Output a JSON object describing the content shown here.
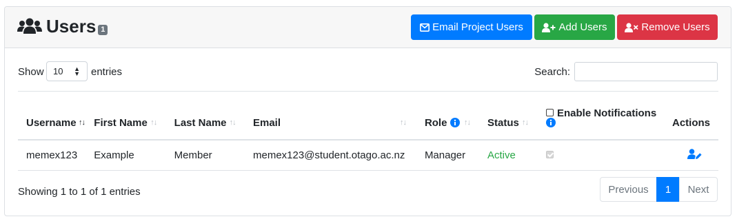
{
  "header": {
    "title": "Users",
    "badge": "1",
    "buttons": {
      "email": "Email Project Users",
      "add": "Add Users",
      "remove": "Remove Users"
    }
  },
  "controls": {
    "show_label": "Show",
    "page_size": "10",
    "entries_label": "entries",
    "search_label": "Search:",
    "search_value": ""
  },
  "table": {
    "columns": {
      "username": "Username",
      "first_name": "First Name",
      "last_name": "Last Name",
      "email": "Email",
      "role": "Role",
      "status": "Status",
      "notifications": "Enable Notifications",
      "actions": "Actions"
    },
    "rows": [
      {
        "username": "memex123",
        "first_name": "Example",
        "last_name": "Member",
        "email": "memex123@student.otago.ac.nz",
        "role": "Manager",
        "status": "Active",
        "notifications_enabled": true
      }
    ]
  },
  "footer": {
    "info": "Showing 1 to 1 of 1 entries",
    "previous": "Previous",
    "page": "1",
    "next": "Next"
  },
  "colors": {
    "primary": "#007bff",
    "success": "#28a745",
    "danger": "#dc3545",
    "badge": "#6c757d"
  },
  "icons": {
    "title": "users-icon",
    "email": "envelope-icon",
    "add": "user-plus-icon",
    "remove": "user-times-icon",
    "info": "info-circle-icon",
    "edit": "user-edit-icon"
  }
}
